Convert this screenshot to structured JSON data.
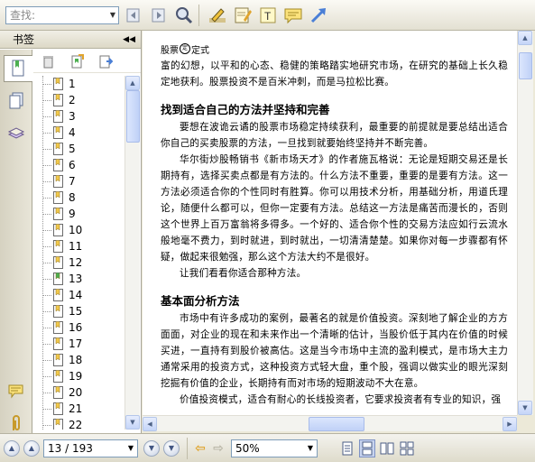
{
  "toolbar": {
    "search_placeholder": "查找:"
  },
  "bookmarks_panel": {
    "title": "书签",
    "items": [
      "1",
      "2",
      "3",
      "4",
      "5",
      "6",
      "7",
      "8",
      "9",
      "10",
      "11",
      "12",
      "13",
      "14",
      "15",
      "16",
      "17",
      "18",
      "19",
      "20",
      "21",
      "22"
    ],
    "selected_index": 12
  },
  "document": {
    "header_left": "股票",
    "header_logo": "定",
    "header_right": "定式",
    "para1": "富的幻想，以平和的心态、稳健的策略踏实地研究市场，在研究的基础上长久稳定地获利。股票投资不是百米冲刺，而是马拉松比赛。",
    "heading1": "找到适合自己的方法并坚持和完善",
    "para2": "要想在波诡云谲的股票市场稳定持续获利，最重要的前提就是要总结出适合你自己的买卖股票的方法，一旦找到就要始终坚持并不断完善。",
    "para3": "华尔街炒股畅销书《新市场天才》的作者施瓦格说：无论是短期交易还是长期持有，选择买卖点都是有方法的。什么方法不重要，重要的是要有方法。这一方法必须适合你的个性同时有胜算。你可以用技术分析，用基础分析，用道氏理论，随便什么都可以，但你一定要有方法。总结这一方法是痛苦而漫长的，否则这个世界上百万富翁将多得多。一个好的、适合你个性的交易方法应如行云流水般地毫不费力，到时就进，到时就出，一切清清楚楚。如果你对每一步骤都有怀疑，做起来很勉强，那么这个方法大约不是很好。",
    "para4": "让我们看看你适合那种方法。",
    "heading2": "基本面分析方法",
    "para5": "市场中有许多成功的案例，最著名的就是价值投资。深刻地了解企业的方方面面，对企业的现在和未来作出一个清晰的估计，当股价低于其内在价值的时候买进，一直持有到股价被高估。这是当今市场中主流的盈利模式，是市场大主力通常采用的投资方式，这种投资方式轻大盘，重个股，强调以做实业的眼光深刻挖掘有价值的企业，长期持有而对市场的短期波动不大在意。",
    "para6": "价值投资模式，适合有耐心的长线投资者，它要求投资者有专业的知识，强"
  },
  "status": {
    "page_display": "13 / 193",
    "zoom_display": "50%"
  },
  "colors": {
    "accent": "#7f9db9",
    "bookmark_icon": "#f2c94c",
    "selected_bookmark_icon": "#4caf50"
  }
}
